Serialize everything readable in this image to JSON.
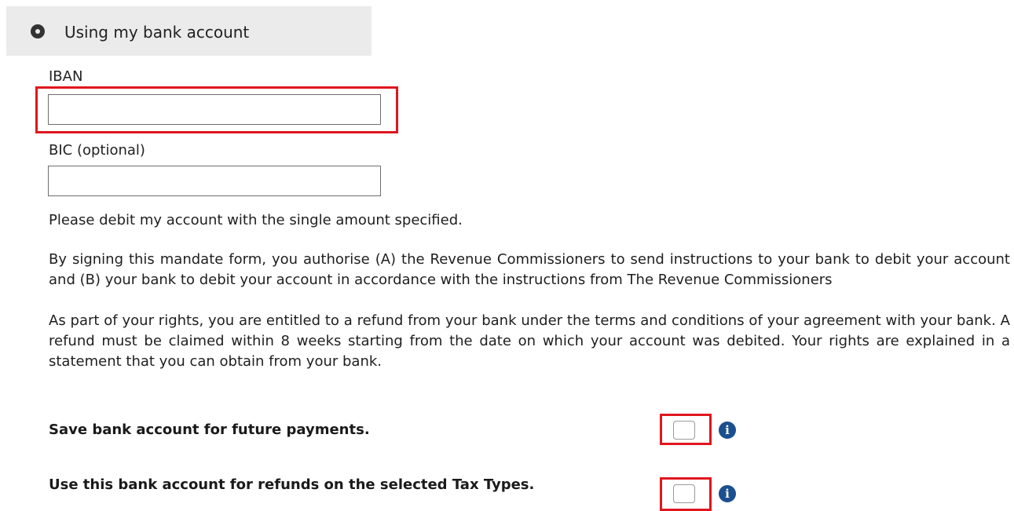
{
  "payment_method": {
    "option_label": "Using my bank account",
    "selected": true
  },
  "iban": {
    "label": "IBAN",
    "value": "",
    "placeholder": ""
  },
  "bic": {
    "label": "BIC (optional)",
    "value": "",
    "placeholder": ""
  },
  "debit_notice": "Please debit my account with the single amount specified.",
  "mandate": {
    "authorisation_text": "By signing this mandate form, you authorise (A) the Revenue Commissioners to send instructions to your bank to debit your account and (B) your bank to debit your account in accordance with the instructions from The Revenue Commissioners",
    "rights_text": "As part of your rights, you are entitled to a refund from your bank under the terms and conditions of your agreement with your bank. A refund must be claimed within 8 weeks starting from the date on which your account was debited. Your rights are explained in a statement that you can obtain from your bank."
  },
  "options": {
    "save_account": {
      "label": "Save bank account for future payments.",
      "checked": false,
      "info_icon": "info-icon"
    },
    "use_for_refunds": {
      "label": "Use this bank account for refunds on the selected Tax Types.",
      "checked": false,
      "info_icon": "info-icon"
    }
  },
  "colors": {
    "highlight": "#e0161e",
    "info_icon": "#1b4f8f",
    "option_background": "#ebebeb"
  }
}
